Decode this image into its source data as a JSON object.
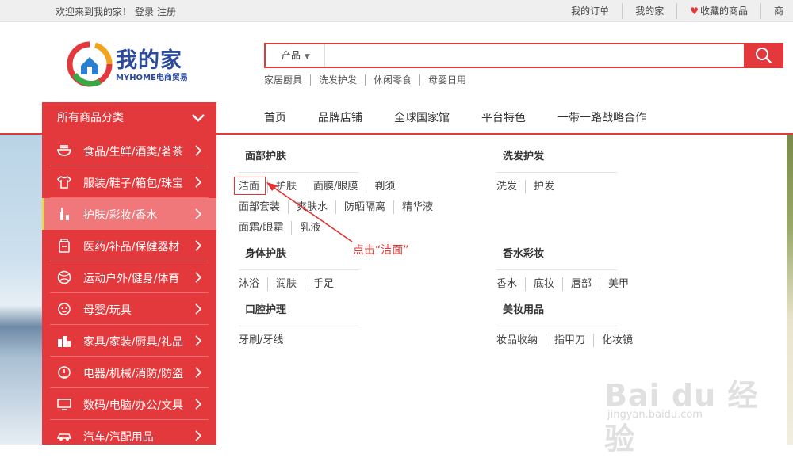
{
  "topbar": {
    "welcome": "欢迎来到我的家！",
    "login": "登录",
    "register": "注册",
    "links": [
      "我的订单",
      "我的家",
      "收藏的商品",
      "商"
    ]
  },
  "logo": {
    "name": "我的家",
    "sub": "MYHOME电商贸易"
  },
  "search": {
    "category": "产品",
    "value": "",
    "hotwords": [
      "家居厨具",
      "洗发护发",
      "休闲零食",
      "母婴日用"
    ]
  },
  "nav": {
    "all_categories": "所有商品分类",
    "items": [
      "首页",
      "品牌店铺",
      "全球国家馆",
      "平台特色",
      "一带一路战略合作"
    ]
  },
  "side_menu": {
    "items": [
      {
        "label": "食品/生鲜/酒类/茗茶",
        "icon": "bowl-icon"
      },
      {
        "label": "服装/鞋子/箱包/珠宝",
        "icon": "shirt-icon"
      },
      {
        "label": "护肤/彩妆/香水",
        "icon": "cosmetics-icon"
      },
      {
        "label": "医药/补品/保健器材",
        "icon": "medicine-icon"
      },
      {
        "label": "运动户外/健身/体育",
        "icon": "ball-icon"
      },
      {
        "label": "母婴/玩具",
        "icon": "baby-icon"
      },
      {
        "label": "家具/家装/厨具/礼品",
        "icon": "building-icon"
      },
      {
        "label": "电器/机械/消防/防盗",
        "icon": "appliance-icon"
      },
      {
        "label": "数码/电脑/办公/文具",
        "icon": "monitor-icon"
      },
      {
        "label": "汽车/汽配用品",
        "icon": "car-icon"
      }
    ]
  },
  "flyout": {
    "groups": [
      {
        "title": "面部护肤",
        "rows": [
          [
            "洁面",
            "护肤",
            "面膜/眼膜",
            "剃须"
          ],
          [
            "面部套装",
            "爽肤水",
            "防晒隔离",
            "精华液"
          ],
          [
            "面霜/眼霜",
            "乳液"
          ]
        ]
      },
      {
        "title": "洗发护发",
        "rows": [
          [
            "洗发",
            "护发"
          ]
        ]
      },
      {
        "title": "身体护肤",
        "rows": [
          [
            "沐浴",
            "润肤",
            "手足"
          ]
        ]
      },
      {
        "title": "香水彩妆",
        "rows": [
          [
            "香水",
            "底妆",
            "唇部",
            "美甲"
          ]
        ]
      },
      {
        "title": "口腔护理",
        "rows": [
          [
            "牙刷/牙线"
          ]
        ]
      },
      {
        "title": "美妆用品",
        "rows": [
          [
            "妆品收纳",
            "指甲刀",
            "化妆镜"
          ]
        ]
      }
    ]
  },
  "annotation": {
    "text": "点击“洁面”",
    "color": "#e23434"
  },
  "watermark": {
    "line1": "Bai du 经验",
    "line2": "jingyan.baidu.com"
  },
  "colors": {
    "brand_red": "#e4393c",
    "logo_blue": "#2b4a9c"
  }
}
